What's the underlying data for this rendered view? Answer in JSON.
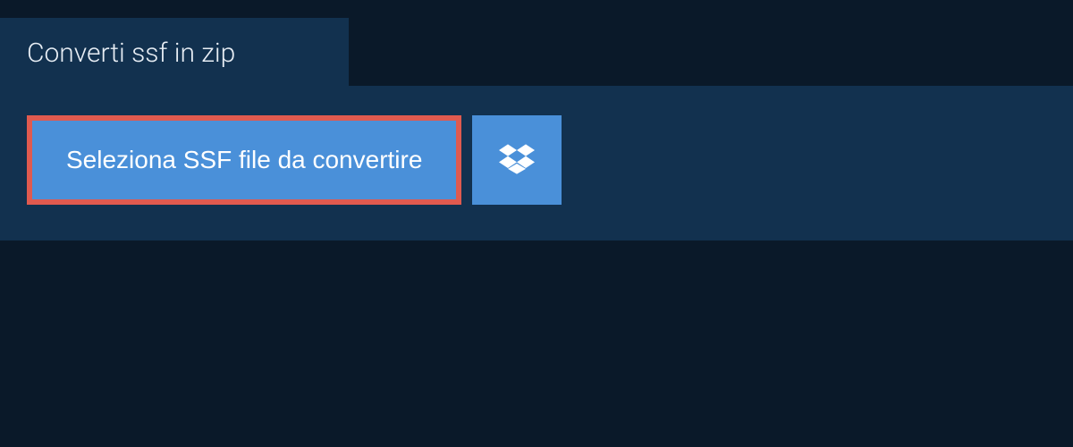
{
  "tab": {
    "title": "Converti ssf in zip"
  },
  "actions": {
    "select_file_label": "Seleziona SSF file da convertire",
    "dropbox_icon": "dropbox-icon"
  },
  "colors": {
    "background": "#0a1929",
    "panel": "#12314f",
    "button": "#4a90d9",
    "highlight_border": "#e05a4f",
    "text_light": "#ffffff"
  }
}
